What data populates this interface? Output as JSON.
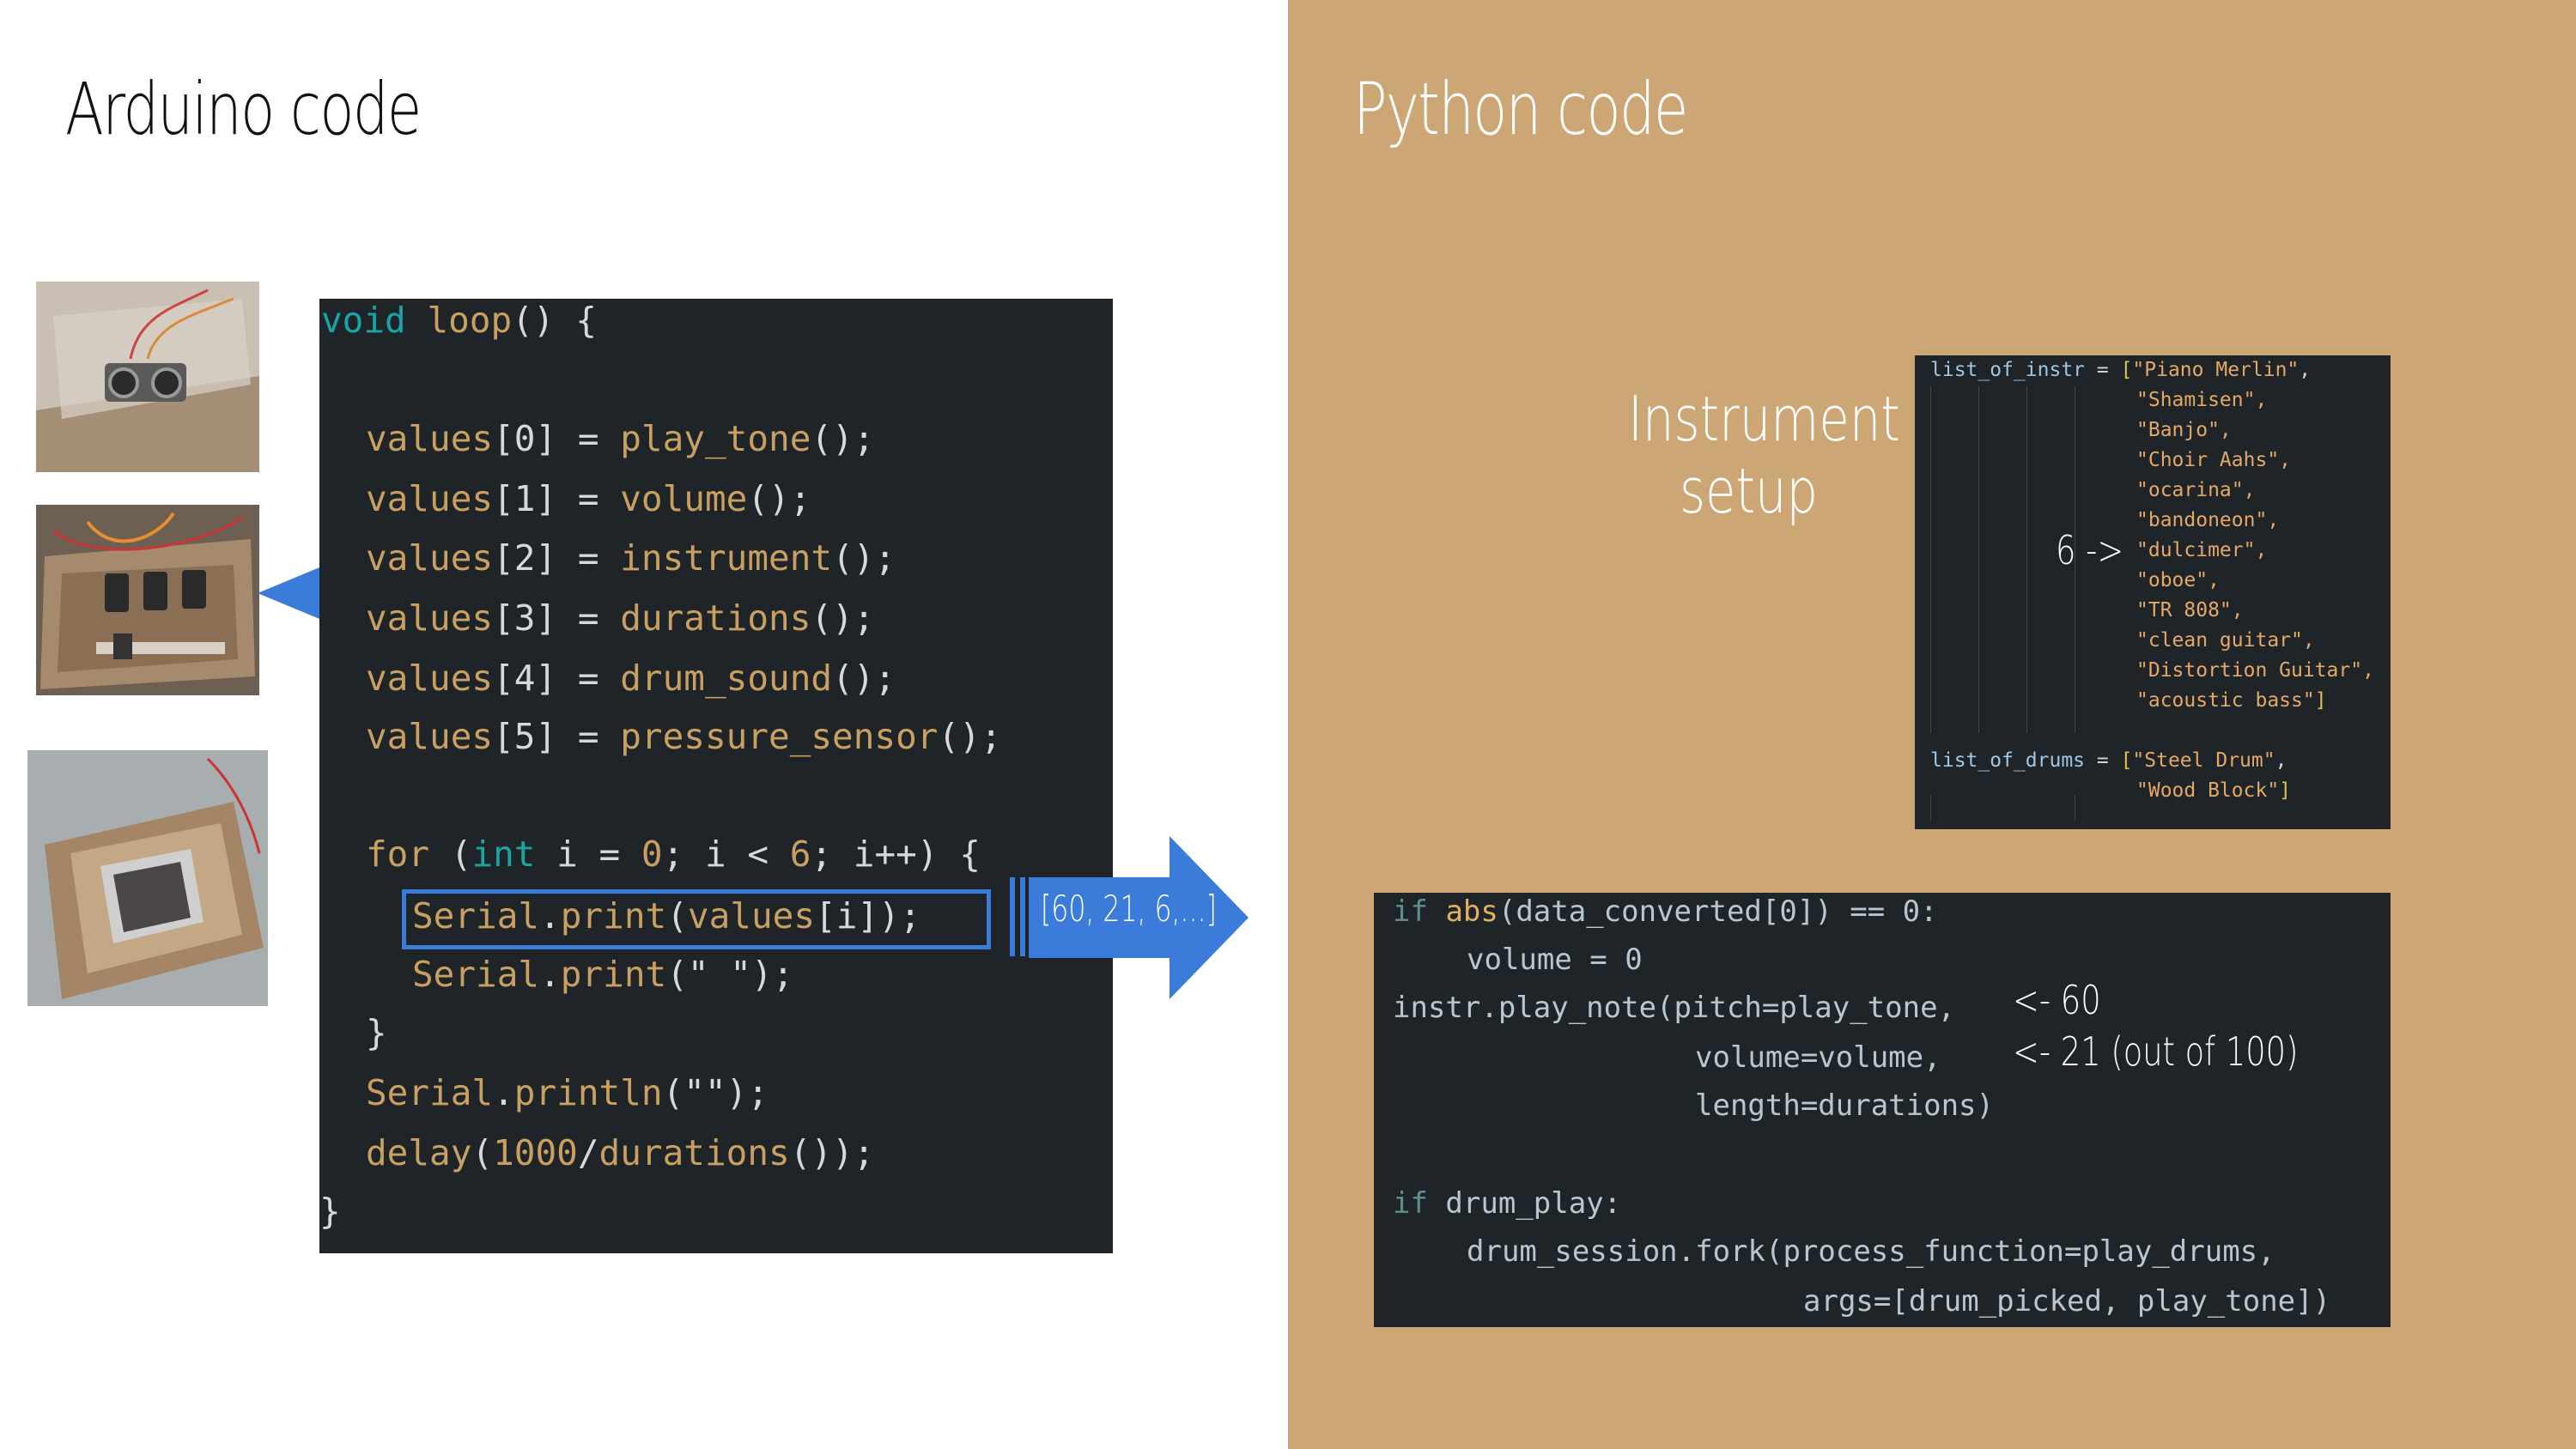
{
  "slide": {
    "left_title": "Arduino code",
    "right_title": "Python code"
  },
  "colors": {
    "left_bg": "#ffffff",
    "right_bg": "#cda676",
    "code_bg": "#1e2428",
    "accent_blue": "#3b7bd9"
  },
  "arduino_code": [
    "void loop() {",
    "",
    "  values[0] = play_tone();",
    "  values[1] = volume();",
    "  values[2] = instrument();",
    "  values[3] = durations();",
    "  values[4] = drum_sound();",
    "  values[5] = pressure_sensor();",
    "",
    "  for (int i = 0; i < 6; i++) {",
    "    Serial.print(values[i]);",
    "    Serial.print(\" \");",
    "  }",
    "  Serial.println(\"\");",
    "  delay(1000/durations());",
    "}"
  ],
  "arrow_label": "[60, 21, 6,...]",
  "instrument_setup": {
    "label_line1": "Instrument",
    "label_line2": "setup",
    "index_marker": "6 ->",
    "code": [
      "list_of_instr = [\"Piano Merlin\",",
      "                 \"Shamisen\",",
      "                 \"Banjo\",",
      "                 \"Choir Aahs\",",
      "                 \"ocarina\",",
      "                 \"bandoneon\",",
      "                 \"dulcimer\",",
      "                 \"oboe\",",
      "                 \"TR 808\",",
      "                 \"clean guitar\",",
      "                 \"Distortion Guitar\",",
      "                 \"acoustic bass\"]",
      "",
      "list_of_drums = [\"Steel Drum\",",
      "                 \"Wood Block\"]"
    ]
  },
  "python_code": [
    "if abs(data_converted[0]) == 0:",
    "    volume = 0",
    "instr.play_note(pitch=play_tone,",
    "                volume=volume,",
    "                length=durations)",
    "",
    "if drum_play:",
    "    drum_session.fork(process_function=play_drums,",
    "                      args=[drum_picked, play_tone])"
  ],
  "annotations": {
    "pitch_note": "<- 60",
    "volume_note": "<- 21 (out of 100)"
  },
  "photos": [
    {
      "name": "ultrasonic-sensor-photo"
    },
    {
      "name": "knob-slider-controls-photo"
    },
    {
      "name": "pressure-pad-photo"
    }
  ]
}
